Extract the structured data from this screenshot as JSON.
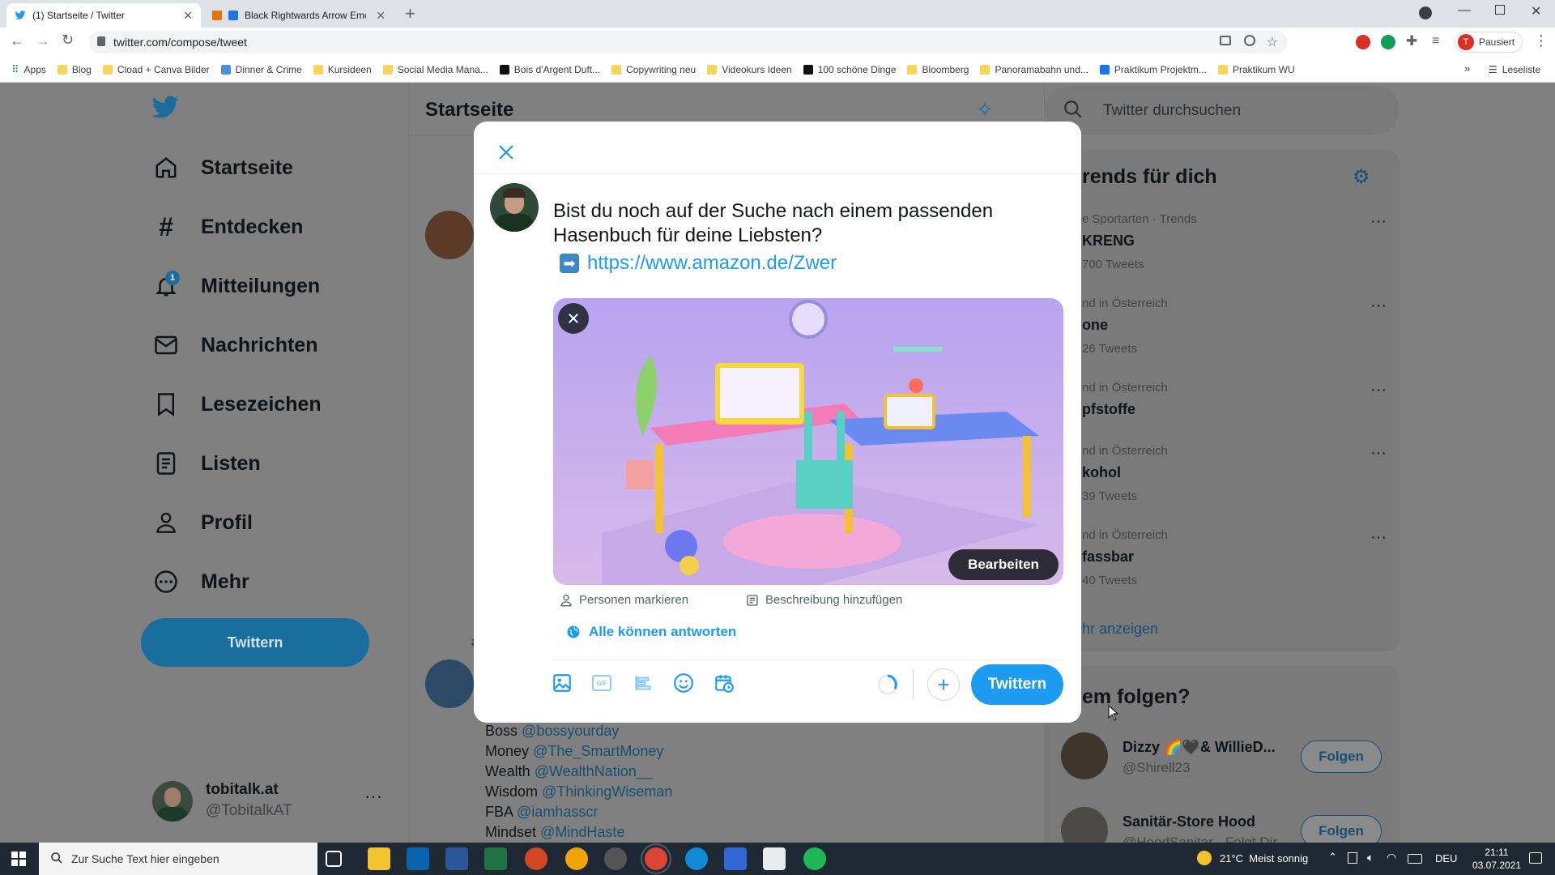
{
  "browser": {
    "tabs": [
      {
        "title": "(1) Startseite / Twitter",
        "active": true
      },
      {
        "title": "Black Rightwards Arrow Emoji",
        "active": false
      }
    ],
    "url": "twitter.com/compose/tweet",
    "profile_status": "Pausiert",
    "profile_initial": "T",
    "bookmarks": [
      "Apps",
      "Blog",
      "Cload + Canva Bilder",
      "Dinner & Crime",
      "Kursideen",
      "Social Media Mana...",
      "Bois d'Argent Duft...",
      "Copywriting neu",
      "Videokurs Ideen",
      "100 schöne Dinge",
      "Bloomberg",
      "Panoramabahn und...",
      "Praktikum Projektm...",
      "Praktikum WU"
    ],
    "reading_list": "Leseliste"
  },
  "nav": {
    "items": [
      "Startseite",
      "Entdecken",
      "Mitteilungen",
      "Nachrichten",
      "Lesezeichen",
      "Listen",
      "Profil",
      "Mehr"
    ],
    "notification_count": "1",
    "tweet_button": "Twittern",
    "account_name": "tobitalk.at",
    "account_handle": "@TobitalkAT"
  },
  "timeline": {
    "title": "Startseite",
    "lines": [
      {
        "label": "Boss",
        "handle": "@bossyourday"
      },
      {
        "label": "Money",
        "handle": "@The_SmartMoney"
      },
      {
        "label": "Wealth",
        "handle": "@WealthNation__"
      },
      {
        "label": "Wisdom",
        "handle": "@ThinkingWiseman"
      },
      {
        "label": "FBA",
        "handle": "@iamhasscr"
      },
      {
        "label": "Mindset",
        "handle": "@MindHaste"
      }
    ]
  },
  "sidebar": {
    "search_placeholder": "Twitter durchsuchen",
    "trends_title": "rends für dich",
    "trends": [
      {
        "meta": "e Sportarten · Trends",
        "name": "KRENG",
        "count": "700 Tweets"
      },
      {
        "meta": "nd in Österreich",
        "name": "one",
        "count": "26 Tweets"
      },
      {
        "meta": "nd in Österreich",
        "name": "pfstoffe",
        "count": ""
      },
      {
        "meta": "nd in Österreich",
        "name": "kohol",
        "count": "39 Tweets"
      },
      {
        "meta": "nd in Österreich",
        "name": "fassbar",
        "count": "40 Tweets"
      }
    ],
    "show_more": "hr anzeigen",
    "follow_title": "em folgen?",
    "suggestions": [
      {
        "name": "Dizzy 🌈🖤& WillieD...",
        "handle": "@Shirell23",
        "button": "Folgen"
      },
      {
        "name": "Sanitär-Store Hood",
        "handle": "@HoodSanitar · Folgt Dir",
        "button": "Folgen"
      }
    ]
  },
  "compose": {
    "text_line1": "Bist du noch auf der Suche nach einem passenden",
    "text_line2": "Hasenbuch für deine Liebsten?",
    "link": "https://www.amazon.de/Zwer",
    "edit_button": "Bearbeiten",
    "tag_people": "Personen markieren",
    "add_description": "Beschreibung hinzufügen",
    "reply_setting": "Alle können antworten",
    "gif_label": "GIF",
    "submit": "Twittern"
  },
  "taskbar": {
    "search_placeholder": "Zur Suche Text hier eingeben",
    "weather": "21°C  Meist sonnig",
    "lang": "DEU",
    "time": "21:11",
    "date": "03.07.2021"
  },
  "colors": {
    "twitter_blue": "#1d9bf0",
    "dimmed_blue": "#1a6e9e"
  }
}
